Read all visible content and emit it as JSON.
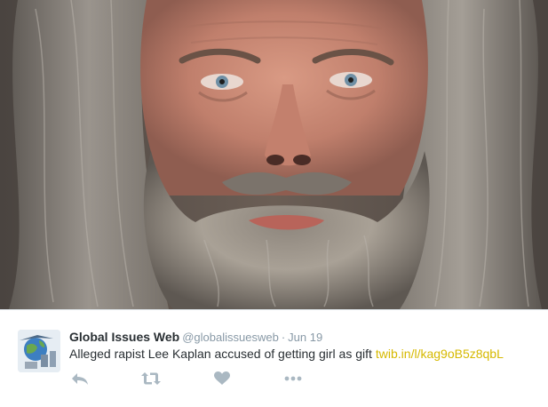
{
  "tweet": {
    "display_name": "Global Issues Web",
    "screen_name": "@globalissuesweb",
    "separator": "·",
    "timestamp": "Jun 19",
    "text": "Alleged rapist Lee Kaplan accused of getting girl as gift",
    "link": "twib.in/l/kag9oB5z8qbL",
    "link_color": "#d6b900"
  },
  "actions": [
    {
      "icon": "reply-icon"
    },
    {
      "icon": "retweet-icon"
    },
    {
      "icon": "like-heart-icon"
    },
    {
      "icon": "more-icon"
    }
  ],
  "colors": {
    "text": "#292f33",
    "muted": "#8899a6",
    "action_icon": "#aab8c2"
  }
}
